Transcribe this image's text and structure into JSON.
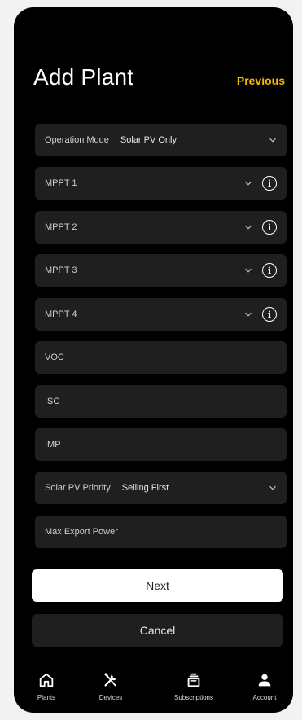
{
  "header": {
    "title": "Add Plant",
    "previous_label": "Previous"
  },
  "fields": [
    {
      "label": "Operation Mode",
      "value": "Solar PV Only",
      "dropdown": true,
      "info": false
    },
    {
      "label": "MPPT 1",
      "value": "",
      "dropdown": true,
      "info": true
    },
    {
      "label": "MPPT 2",
      "value": "",
      "dropdown": true,
      "info": true
    },
    {
      "label": "MPPT 3",
      "value": "",
      "dropdown": true,
      "info": true
    },
    {
      "label": "MPPT 4",
      "value": "",
      "dropdown": true,
      "info": true
    },
    {
      "label": "VOC",
      "value": "",
      "dropdown": false,
      "info": false
    },
    {
      "label": "ISC",
      "value": "",
      "dropdown": false,
      "info": false
    },
    {
      "label": "IMP",
      "value": "",
      "dropdown": false,
      "info": false
    },
    {
      "label": "Solar PV Priority",
      "value": "Selling First",
      "dropdown": true,
      "info": false
    },
    {
      "label": "Max Export Power",
      "value": "",
      "dropdown": false,
      "info": false
    }
  ],
  "buttons": {
    "next": "Next",
    "cancel": "Cancel"
  },
  "tabbar": [
    {
      "label": "Plants",
      "icon": "home-icon"
    },
    {
      "label": "Devices",
      "icon": "tools-icon"
    },
    {
      "label": "Subscriptions",
      "icon": "subscriptions-icon"
    },
    {
      "label": "Account",
      "icon": "person-icon"
    }
  ],
  "colors": {
    "accent": "#f5b800",
    "background": "#000000",
    "field": "#1f1f1f"
  }
}
